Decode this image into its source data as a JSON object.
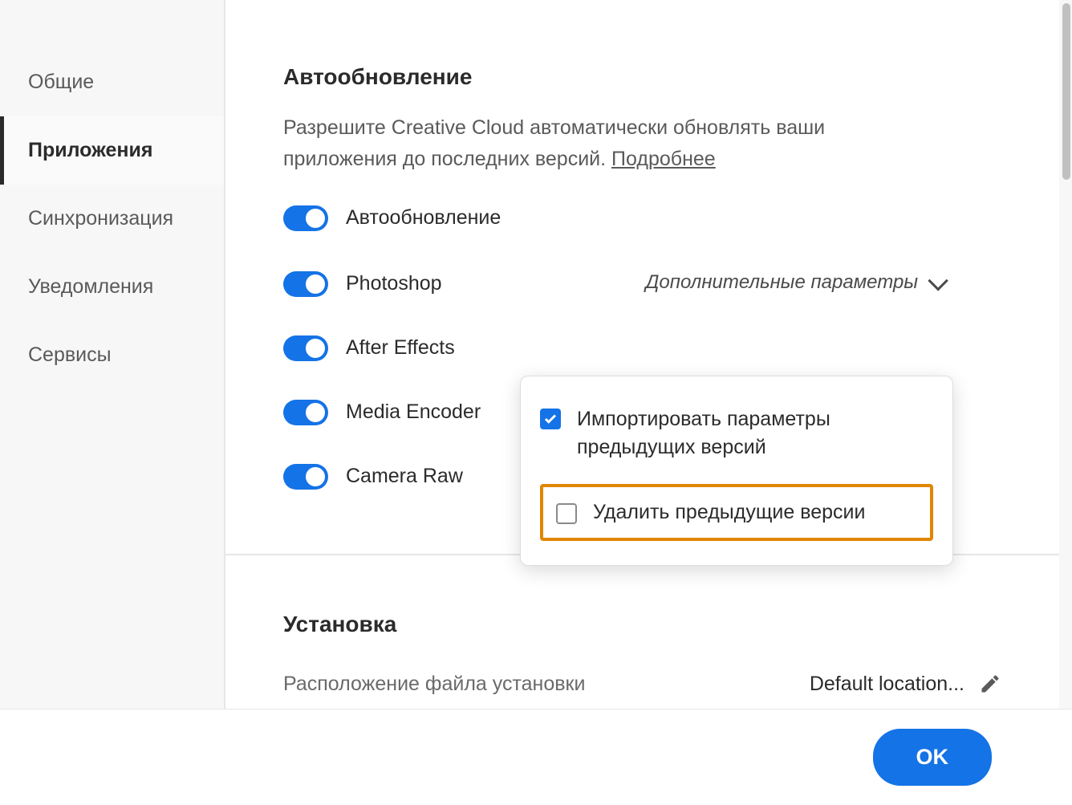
{
  "sidebar": {
    "items": [
      {
        "label": "Общие"
      },
      {
        "label": "Приложения"
      },
      {
        "label": "Синхронизация"
      },
      {
        "label": "Уведомления"
      },
      {
        "label": "Сервисы"
      }
    ]
  },
  "autoupdate": {
    "title": "Автообновление",
    "desc_prefix": "Разрешите Creative Cloud автоматически обновлять ваши приложения до последних версий. ",
    "more_link": "Подробнее",
    "master_label": "Автообновление",
    "advanced_label": "Дополнительные параметры",
    "apps": [
      {
        "label": "Photoshop"
      },
      {
        "label": "After Effects"
      },
      {
        "label": "Media Encoder"
      },
      {
        "label": "Camera Raw"
      }
    ]
  },
  "popover": {
    "import_label": "Импортировать параметры предыдущих версий",
    "delete_label": "Удалить предыдущие версии"
  },
  "install": {
    "title": "Установка",
    "location_label": "Расположение файла установки",
    "location_value": "Default location..."
  },
  "footer": {
    "ok": "OK"
  }
}
